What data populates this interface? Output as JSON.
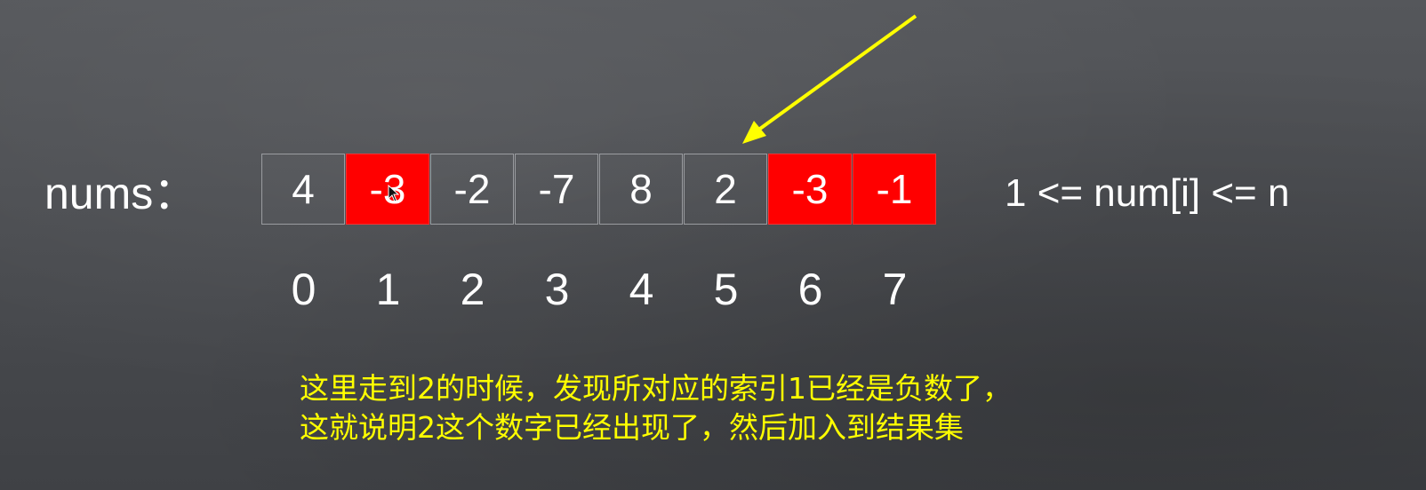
{
  "array_label": "nums：",
  "cells": [
    {
      "value": "4",
      "highlight": false
    },
    {
      "value": "-3",
      "highlight": true
    },
    {
      "value": "-2",
      "highlight": false
    },
    {
      "value": "-7",
      "highlight": false
    },
    {
      "value": "8",
      "highlight": false
    },
    {
      "value": "2",
      "highlight": false
    },
    {
      "value": "-3",
      "highlight": true
    },
    {
      "value": "-1",
      "highlight": true
    }
  ],
  "indices": [
    "0",
    "1",
    "2",
    "3",
    "4",
    "5",
    "6",
    "7"
  ],
  "constraint": "1 <= num[i] <= n",
  "note_lines": [
    "这里走到2的时候，发现所对应的索引1已经是负数了，",
    "这就说明2这个数字已经出现了，然后加入到结果集"
  ],
  "colors": {
    "highlight": "#ff0000",
    "arrow": "#ffff00",
    "text": "#ffffff",
    "note": "#ffff00"
  },
  "arrow_target_index": 5
}
